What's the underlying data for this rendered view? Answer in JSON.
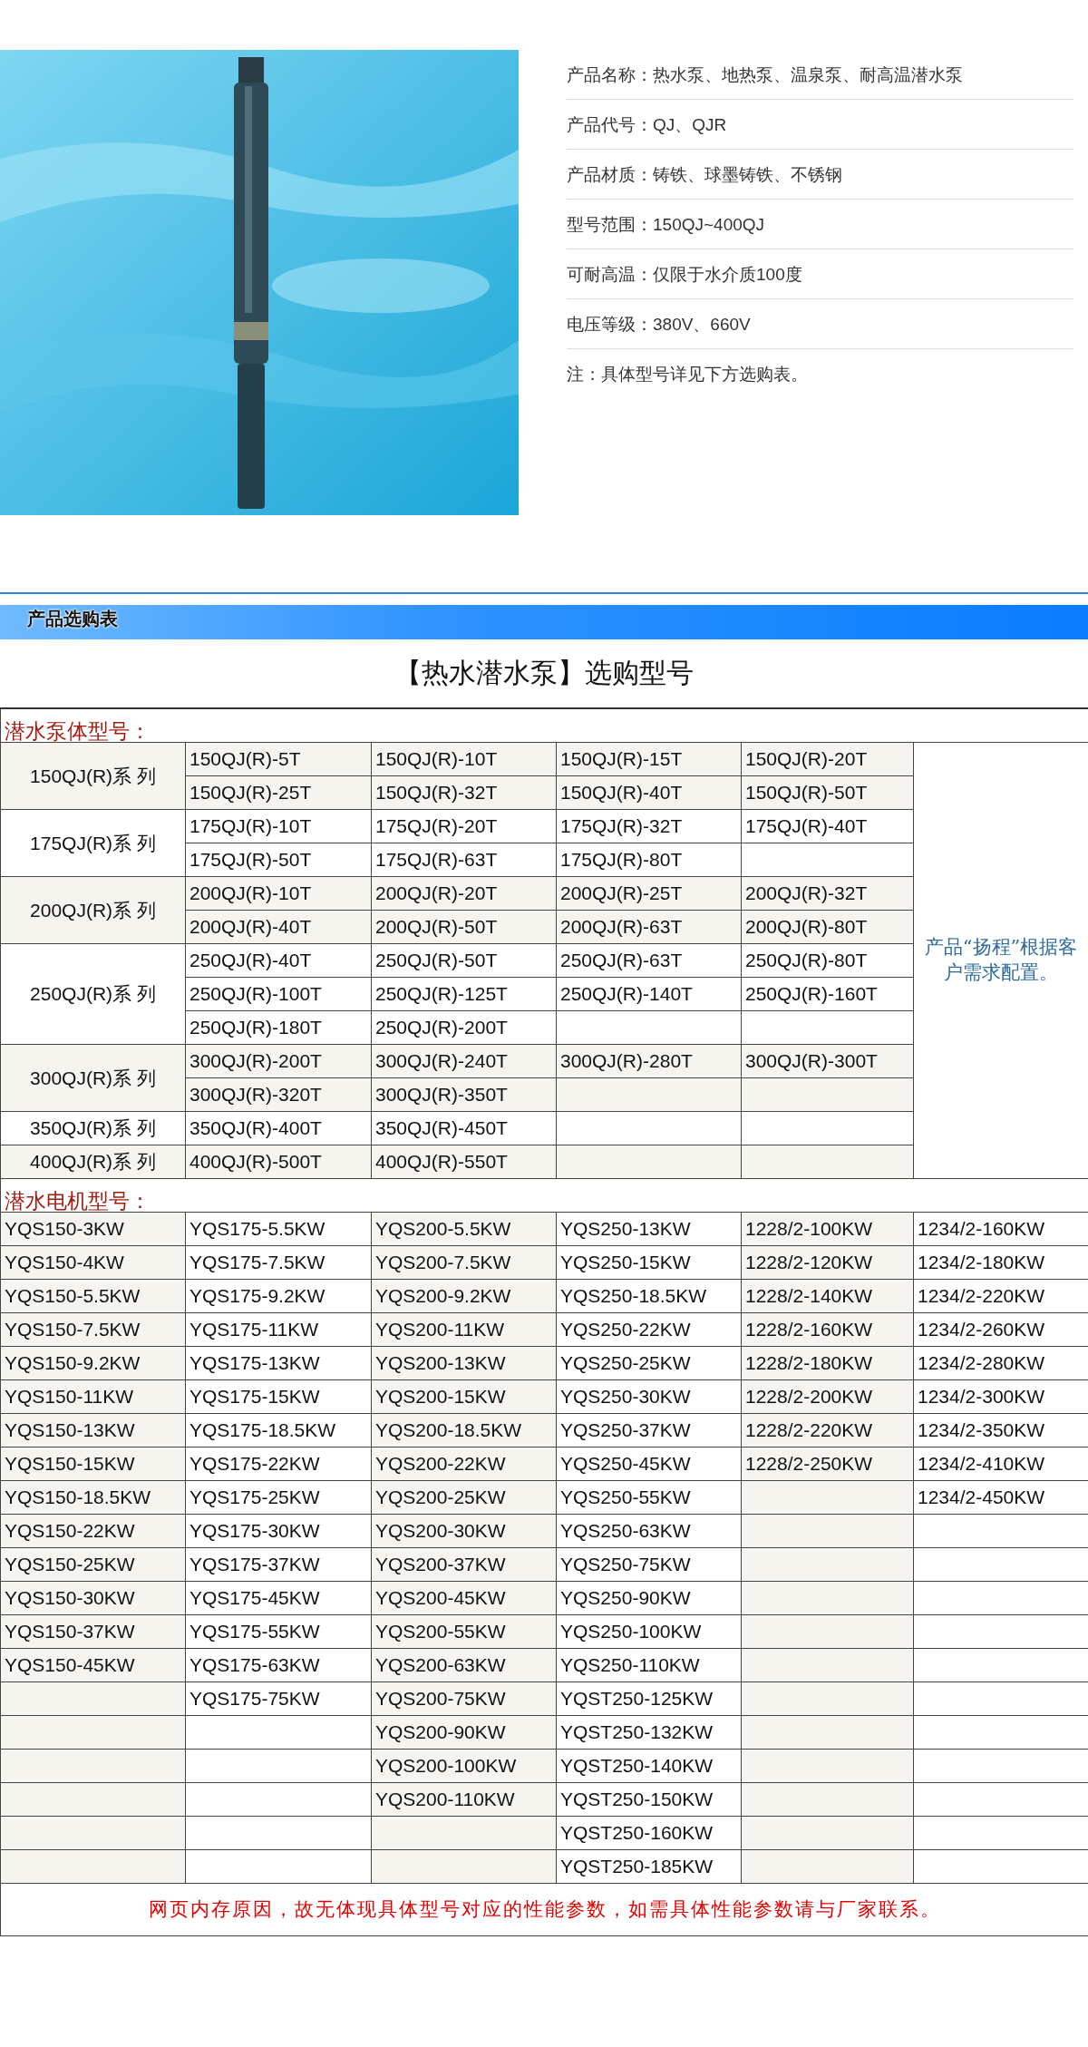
{
  "product_photo": {
    "kind": "picture"
  },
  "product_info": [
    "产品名称：热水泵、地热泵、温泉泵、耐高温潜水泵",
    "产品代号：QJ、QJR",
    "产品材质：铸铁、球墨铸铁、不锈钢",
    "型号范围：150QJ~400QJ",
    "可耐高温：仅限于水介质100度",
    "电压等级：380V、660V",
    "注：具体型号详见下方选购表。"
  ],
  "section_title": "产品选购表",
  "table_title": "【热水潜水泵】选购型号",
  "pump_section": {
    "heading": "潜水泵体型号：",
    "note": "产品“扬程”根据客户需求配置。",
    "series": [
      {
        "name": "150QJ(R)系 列",
        "rows": [
          [
            "150QJ(R)-5T",
            "150QJ(R)-10T",
            "150QJ(R)-15T",
            "150QJ(R)-20T"
          ],
          [
            "150QJ(R)-25T",
            "150QJ(R)-32T",
            "150QJ(R)-40T",
            "150QJ(R)-50T"
          ]
        ]
      },
      {
        "name": "175QJ(R)系 列",
        "rows": [
          [
            "175QJ(R)-10T",
            "175QJ(R)-20T",
            "175QJ(R)-32T",
            "175QJ(R)-40T"
          ],
          [
            "175QJ(R)-50T",
            "175QJ(R)-63T",
            "175QJ(R)-80T"
          ]
        ]
      },
      {
        "name": "200QJ(R)系 列",
        "rows": [
          [
            "200QJ(R)-10T",
            "200QJ(R)-20T",
            "200QJ(R)-25T",
            "200QJ(R)-32T"
          ],
          [
            "200QJ(R)-40T",
            "200QJ(R)-50T",
            "200QJ(R)-63T",
            "200QJ(R)-80T"
          ]
        ]
      },
      {
        "name": "250QJ(R)系 列",
        "rows": [
          [
            "250QJ(R)-40T",
            "250QJ(R)-50T",
            "250QJ(R)-63T",
            "250QJ(R)-80T"
          ],
          [
            "250QJ(R)-100T",
            "250QJ(R)-125T",
            "250QJ(R)-140T",
            "250QJ(R)-160T"
          ],
          [
            "250QJ(R)-180T",
            "250QJ(R)-200T"
          ]
        ]
      },
      {
        "name": "300QJ(R)系 列",
        "rows": [
          [
            "300QJ(R)-200T",
            "300QJ(R)-240T",
            "300QJ(R)-280T",
            "300QJ(R)-300T"
          ],
          [
            "300QJ(R)-320T",
            "300QJ(R)-350T"
          ]
        ]
      },
      {
        "name": "350QJ(R)系 列",
        "rows": [
          [
            "350QJ(R)-400T",
            "350QJ(R)-450T"
          ]
        ]
      },
      {
        "name": "400QJ(R)系 列",
        "rows": [
          [
            "400QJ(R)-500T",
            "400QJ(R)-550T"
          ]
        ]
      }
    ]
  },
  "motor_section": {
    "heading": "潜水电机型号：",
    "columns": [
      [
        "YQS150-3KW",
        "YQS150-4KW",
        "YQS150-5.5KW",
        "YQS150-7.5KW",
        "YQS150-9.2KW",
        "YQS150-11KW",
        "YQS150-13KW",
        "YQS150-15KW",
        "YQS150-18.5KW",
        "YQS150-22KW",
        "YQS150-25KW",
        "YQS150-30KW",
        "YQS150-37KW",
        "YQS150-45KW"
      ],
      [
        "YQS175-5.5KW",
        "YQS175-7.5KW",
        "YQS175-9.2KW",
        "YQS175-11KW",
        "YQS175-13KW",
        "YQS175-15KW",
        "YQS175-18.5KW",
        "YQS175-22KW",
        "YQS175-25KW",
        "YQS175-30KW",
        "YQS175-37KW",
        "YQS175-45KW",
        "YQS175-55KW",
        "YQS175-63KW",
        "YQS175-75KW"
      ],
      [
        "YQS200-5.5KW",
        "YQS200-7.5KW",
        "YQS200-9.2KW",
        "YQS200-11KW",
        "YQS200-13KW",
        "YQS200-15KW",
        "YQS200-18.5KW",
        "YQS200-22KW",
        "YQS200-25KW",
        "YQS200-30KW",
        "YQS200-37KW",
        "YQS200-45KW",
        "YQS200-55KW",
        "YQS200-63KW",
        "YQS200-75KW",
        "YQS200-90KW",
        "YQS200-100KW",
        "YQS200-110KW"
      ],
      [
        "YQS250-13KW",
        "YQS250-15KW",
        "YQS250-18.5KW",
        "YQS250-22KW",
        "YQS250-25KW",
        "YQS250-30KW",
        "YQS250-37KW",
        "YQS250-45KW",
        "YQS250-55KW",
        "YQS250-63KW",
        "YQS250-75KW",
        "YQS250-90KW",
        "YQS250-100KW",
        "YQS250-110KW",
        "YQST250-125KW",
        "YQST250-132KW",
        "YQST250-140KW",
        "YQST250-150KW",
        "YQST250-160KW",
        "YQST250-185KW"
      ],
      [
        "1228/2-100KW",
        "1228/2-120KW",
        "1228/2-140KW",
        "1228/2-160KW",
        "1228/2-180KW",
        "1228/2-200KW",
        "1228/2-220KW",
        "1228/2-250KW"
      ],
      [
        "1234/2-160KW",
        "1234/2-180KW",
        "1234/2-220KW",
        "1234/2-260KW",
        "1234/2-280KW",
        "1234/2-300KW",
        "1234/2-350KW",
        "1234/2-410KW",
        "1234/2-450KW"
      ]
    ]
  },
  "footer_note": "网页内存原因，故无体现具体型号对应的性能参数，如需具体性能参数请与厂家联系。"
}
